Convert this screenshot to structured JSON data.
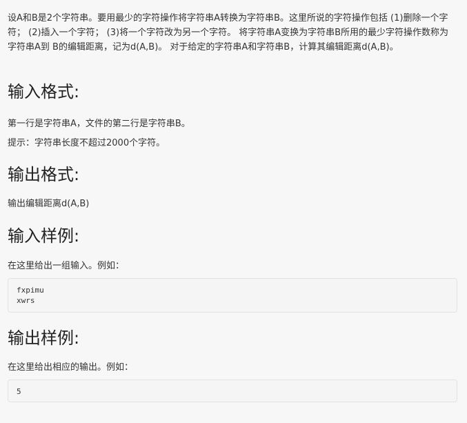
{
  "intro": {
    "text": "设A和B是2个字符串。要用最少的字符操作将字符串A转换为字符串B。这里所说的字符操作包括 (1)删除一个字符； (2)插入一个字符； (3)将一个字符改为另一个字符。 将字符串A变换为字符串B所用的最少字符操作数称为字符串A到 B的编辑距离，记为d(A,B)。 对于给定的字符串A和字符串B，计算其编辑距离d(A,B)。"
  },
  "input_format": {
    "heading": "输入格式:",
    "line1": "第一行是字符串A，文件的第二行是字符串B。",
    "line2": "提示：字符串长度不超过2000个字符。"
  },
  "output_format": {
    "heading": "输出格式:",
    "line1": "输出编辑距离d(A,B)"
  },
  "input_sample": {
    "heading": "输入样例:",
    "desc": "在这里给出一组输入。例如：",
    "code": "fxpimu\nxwrs"
  },
  "output_sample": {
    "heading": "输出样例:",
    "desc": "在这里给出相应的输出。例如：",
    "code": "5"
  }
}
